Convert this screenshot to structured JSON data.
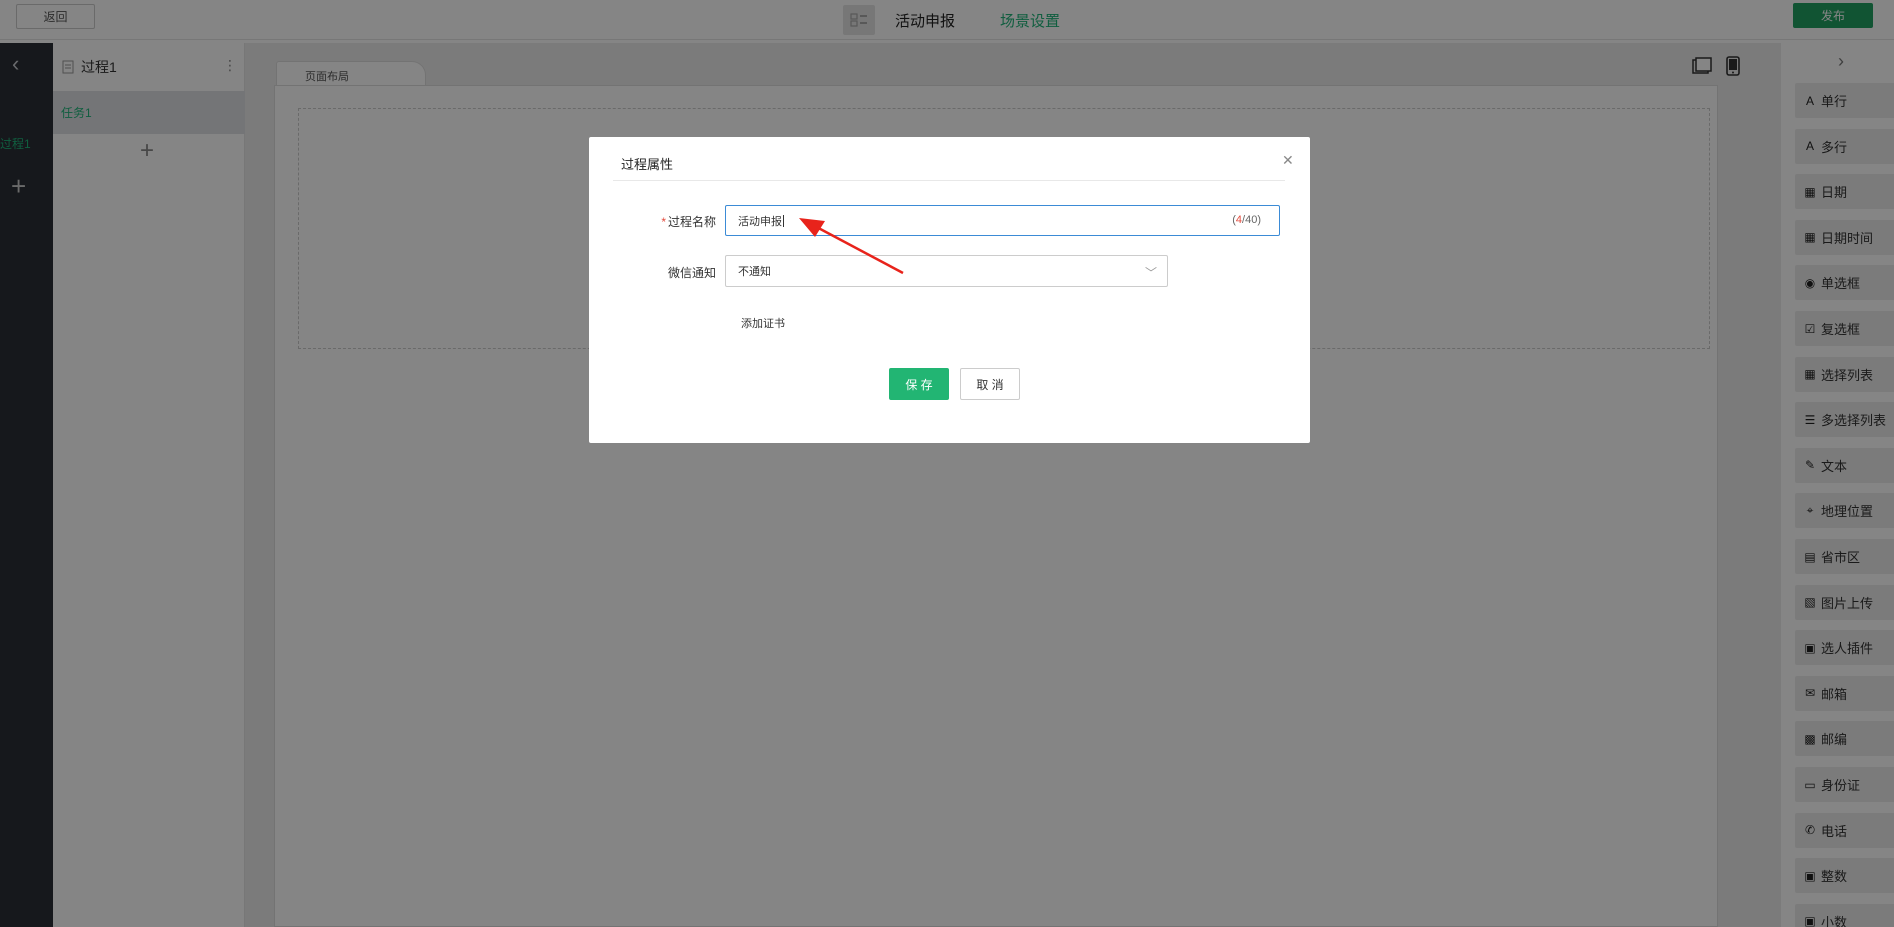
{
  "topbar": {
    "back_label": "返回",
    "title": "活动申报",
    "scene_label": "场景设置",
    "publish_label": "发布"
  },
  "leftbar": {
    "process_label": "过程1"
  },
  "process_panel": {
    "title": "过程1",
    "task_label": "任务1"
  },
  "canvas": {
    "tab_label": "页面布局"
  },
  "widgets": [
    {
      "label": "单行",
      "icon": "single-line-icon"
    },
    {
      "label": "多行",
      "icon": "multi-line-icon"
    },
    {
      "label": "日期",
      "icon": "calendar-icon"
    },
    {
      "label": "日期时间",
      "icon": "datetime-icon"
    },
    {
      "label": "单选框",
      "icon": "radio-icon"
    },
    {
      "label": "复选框",
      "icon": "checkbox-icon"
    },
    {
      "label": "选择列表",
      "icon": "grid-icon"
    },
    {
      "label": "多选择列表",
      "icon": "list-icon"
    },
    {
      "label": "文本",
      "icon": "edit-icon"
    },
    {
      "label": "地理位置",
      "icon": "location-icon"
    },
    {
      "label": "省市区",
      "icon": "map-icon"
    },
    {
      "label": "图片上传",
      "icon": "image-icon"
    },
    {
      "label": "选人插件",
      "icon": "person-icon"
    },
    {
      "label": "邮箱",
      "icon": "mail-icon"
    },
    {
      "label": "邮编",
      "icon": "postcode-icon"
    },
    {
      "label": "身份证",
      "icon": "id-card-icon"
    },
    {
      "label": "电话",
      "icon": "phone-icon"
    },
    {
      "label": "整数",
      "icon": "integer-icon"
    },
    {
      "label": "小数",
      "icon": "decimal-icon"
    }
  ],
  "modal": {
    "title": "过程属性",
    "name_label": "过程名称",
    "required_mark": "*",
    "name_value": "活动申报",
    "counter_current": "4",
    "counter_rest": "/40)",
    "counter_open": "(",
    "wechat_label": "微信通知",
    "wechat_value": "不通知",
    "add_cert_label": "添加证书",
    "save_label": "保 存",
    "cancel_label": "取 消"
  },
  "colors": {
    "accent_green": "#1fb47a",
    "publish_green": "#22a163",
    "required_red": "#e34a3c",
    "focus_blue": "#3b8bd6"
  }
}
